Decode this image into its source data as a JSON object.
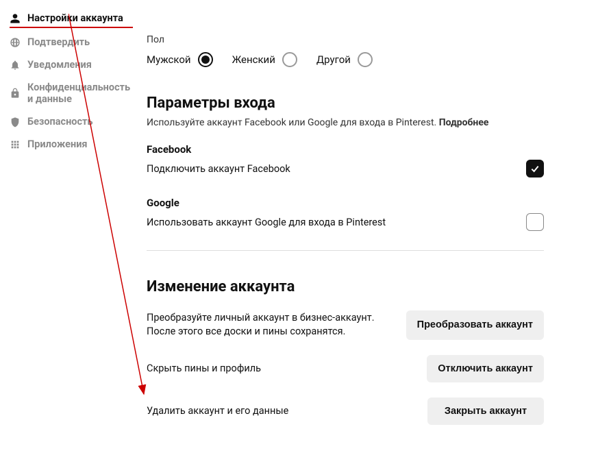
{
  "sidebar": {
    "items": [
      {
        "label": "Настройки аккаунта",
        "icon": "person-icon",
        "active": true
      },
      {
        "label": "Подтвердить",
        "icon": "globe-icon",
        "active": false
      },
      {
        "label": "Уведомления",
        "icon": "bell-icon",
        "active": false
      },
      {
        "label": "Конфиденциальность и данные",
        "icon": "lock-icon",
        "active": false
      },
      {
        "label": "Безопасность",
        "icon": "shield-icon",
        "active": false
      },
      {
        "label": "Приложения",
        "icon": "grid-icon",
        "active": false
      }
    ]
  },
  "gender": {
    "label": "Пол",
    "options": [
      {
        "label": "Мужской",
        "selected": true
      },
      {
        "label": "Женский",
        "selected": false
      },
      {
        "label": "Другой",
        "selected": false
      }
    ]
  },
  "login": {
    "title": "Параметры входа",
    "subtitle_prefix": "Используйте аккаунт Facebook или Google для входа в Pinterest. ",
    "subtitle_link": "Подробнее",
    "providers": [
      {
        "name": "Facebook",
        "desc": "Подключить аккаунт Facebook",
        "checked": true
      },
      {
        "name": "Google",
        "desc": "Использовать аккаунт Google для входа в Pinterest",
        "checked": false
      }
    ]
  },
  "account_change": {
    "title": "Изменение аккаунта",
    "rows": [
      {
        "text": "Преобразуйте личный аккаунт в бизнес-аккаунт. После этого все доски и пины сохранятся.",
        "button": "Преобразовать аккаунт",
        "multiline": true
      },
      {
        "text": "Скрыть пины и профиль",
        "button": "Отключить аккаунт",
        "multiline": false
      },
      {
        "text": "Удалить аккаунт и его данные",
        "button": "Закрыть аккаунт",
        "multiline": false
      }
    ]
  }
}
